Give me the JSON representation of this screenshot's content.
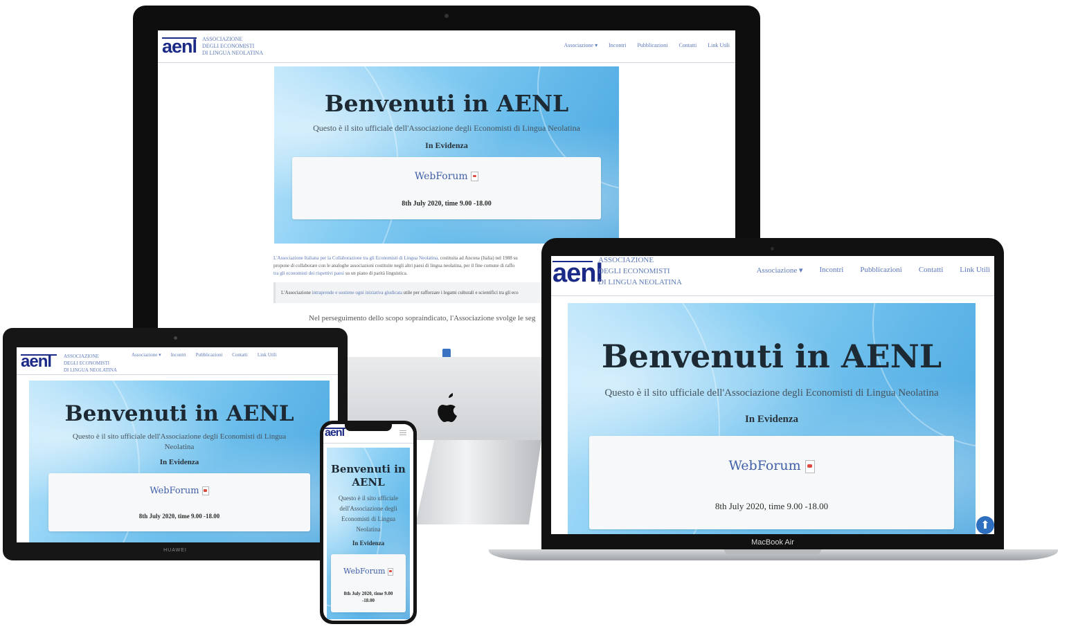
{
  "site": {
    "logo": "aenl",
    "org_line1": "ASSOCIAZIONE",
    "org_line2": "DEGLI ECONOMISTI",
    "org_line3": "DI LINGUA NEOLATINA",
    "menu": [
      "Associazione ▾",
      "Incontri",
      "Pubblicazioni",
      "Contatti",
      "Link Utili"
    ],
    "hero_title": "Benvenuti in AENL",
    "hero_subtitle": "Questo è il sito ufficiale dell'Associazione degli Economisti di Lingua Neolatina",
    "in_evidenza": "In Evidenza",
    "webforum_link": "WebForum",
    "webforum_date": "8th July 2020, time 9.00 -18.00",
    "pdf_icon": "pdf-file-icon",
    "body_line1_link": "L'Associazione Italiana per la Collaborazione tra gli Economisti di Lingua Neolatina,",
    "body_line1_rest": " costituita ad Ancona (Italia) nel 1988 su",
    "body_line2": "propone di collaborare con le analoghe associazioni costituite negli altri paesi di lingua neolatina, per il fine comune di raffo",
    "body_line3_link": "tra gli economisti dei rispettivi paesi",
    "body_line3_rest": " su un piano di parità linguistica.",
    "quote_start": "L'Associazione ",
    "quote_link": "intraprende e sostiene ogni iniziativa giudicata",
    "quote_rest": " utile per rafforzare i legami culturali e scientifici tra gli eco",
    "pursuit_text": "Nel perseguimento dello scopo sopraindicato, l'Associazione svolge le seg",
    "phone_title_l1": "Benvenuti in",
    "phone_title_l2": "AENL",
    "phone_sub_l1": "Questo è il sito ufficiale",
    "phone_sub_l2": "dell'Associazione degli",
    "phone_sub_l3": "Economisti di Lingua",
    "phone_sub_l4": "Neolatina",
    "phone_date_l1": "8th July 2020, time 9.00",
    "phone_date_l2": "-18.00",
    "tablet_sub_l1": "Questo è il sito ufficiale dell'Associazione degli Economisti di Lingua",
    "tablet_sub_l2": "Neolatina"
  },
  "devices": {
    "macbook_label": "MacBook Air",
    "tablet_brand": "HUAWEI",
    "apple_logo": "apple-logo-icon",
    "scroll_top_icon": "arrow-up-icon",
    "scroll_top_glyph": "⬆",
    "hamburger_icon": "hamburger-menu-icon"
  }
}
